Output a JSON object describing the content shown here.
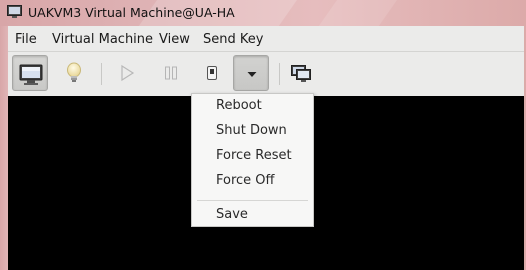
{
  "window": {
    "title": "UAKVM3 Virtual Machine@UA-HA",
    "icon": "monitor-app-icon"
  },
  "menubar": {
    "items": [
      {
        "label": "File"
      },
      {
        "label": "Virtual Machine"
      },
      {
        "label": "View"
      },
      {
        "label": "Send Key"
      }
    ]
  },
  "toolbar": {
    "buttons": [
      {
        "name": "show-console-button",
        "icon": "monitor-icon",
        "state": "active"
      },
      {
        "name": "show-details-button",
        "icon": "lightbulb-icon",
        "state": "normal"
      },
      {
        "name": "run-button",
        "icon": "play-icon",
        "state": "disabled"
      },
      {
        "name": "pause-button",
        "icon": "pause-icon",
        "state": "disabled"
      },
      {
        "name": "shutdown-button",
        "icon": "power-switch-icon",
        "state": "normal"
      },
      {
        "name": "shutdown-menu-button",
        "icon": "chevron-down-icon",
        "state": "pressed"
      },
      {
        "name": "fullscreen-button",
        "icon": "screens-icon",
        "state": "normal"
      }
    ]
  },
  "shutdown_menu": {
    "items": [
      {
        "label": "Reboot"
      },
      {
        "label": "Shut Down"
      },
      {
        "label": "Force Reset"
      },
      {
        "label": "Force Off"
      },
      {
        "label": "Save"
      }
    ]
  },
  "colors": {
    "titlebar": "#dfb3b5",
    "chrome": "#ebebea",
    "console": "#000000",
    "menu_bg": "#f7f7f6"
  }
}
